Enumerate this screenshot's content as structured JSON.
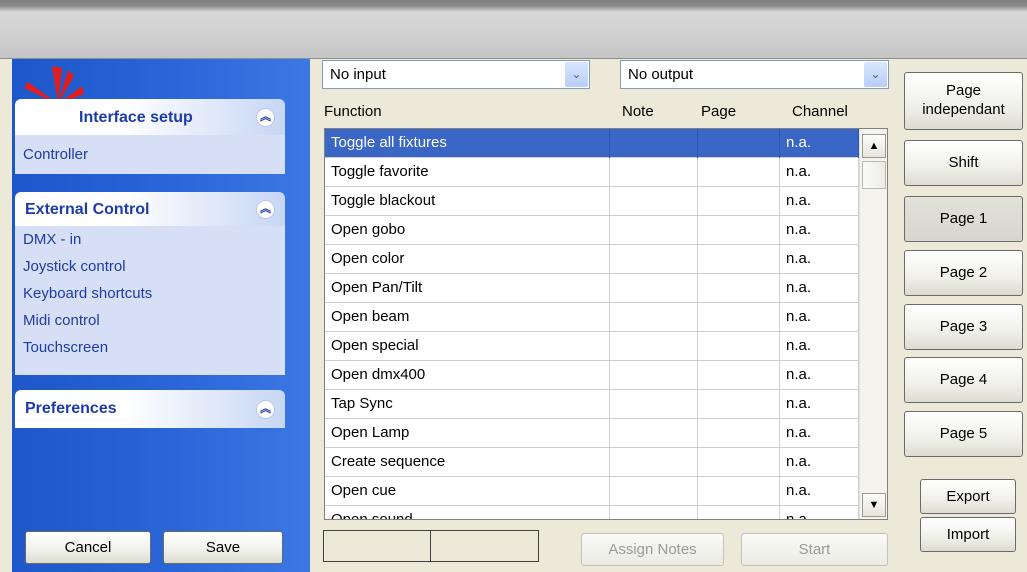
{
  "sidebar": {
    "groups": [
      {
        "title": "Interface setup",
        "items": [
          "Controller"
        ]
      },
      {
        "title": "External Control",
        "items": [
          "DMX - in",
          "Joystick control",
          "Keyboard shortcuts",
          "Midi control",
          "Touchscreen"
        ]
      },
      {
        "title": "Preferences",
        "items": []
      }
    ],
    "cancel_label": "Cancel",
    "save_label": "Save"
  },
  "input_select": {
    "value": "No input"
  },
  "output_select": {
    "value": "No output"
  },
  "table": {
    "columns": [
      "Function",
      "Note",
      "Page",
      "Channel"
    ],
    "rows": [
      {
        "function": "Toggle all fixtures",
        "note": "",
        "page": "",
        "channel": "n.a."
      },
      {
        "function": "Toggle favorite",
        "note": "",
        "page": "",
        "channel": "n.a."
      },
      {
        "function": "Toggle blackout",
        "note": "",
        "page": "",
        "channel": "n.a."
      },
      {
        "function": "Open gobo",
        "note": "",
        "page": "",
        "channel": "n.a."
      },
      {
        "function": "Open color",
        "note": "",
        "page": "",
        "channel": "n.a."
      },
      {
        "function": "Open Pan/Tilt",
        "note": "",
        "page": "",
        "channel": "n.a."
      },
      {
        "function": "Open beam",
        "note": "",
        "page": "",
        "channel": "n.a."
      },
      {
        "function": "Open special",
        "note": "",
        "page": "",
        "channel": "n.a."
      },
      {
        "function": "Open dmx400",
        "note": "",
        "page": "",
        "channel": "n.a."
      },
      {
        "function": "Tap Sync",
        "note": "",
        "page": "",
        "channel": "n.a."
      },
      {
        "function": "Open Lamp",
        "note": "",
        "page": "",
        "channel": "n.a."
      },
      {
        "function": "Create sequence",
        "note": "",
        "page": "",
        "channel": "n.a."
      },
      {
        "function": "Open cue",
        "note": "",
        "page": "",
        "channel": "n.a."
      },
      {
        "function": "Open sound",
        "note": "",
        "page": "",
        "channel": "n.a."
      }
    ],
    "selected_row": 0
  },
  "actions": {
    "assign_notes_label": "Assign Notes",
    "start_label": "Start"
  },
  "right_panel": {
    "page_independant_label": "Page independant",
    "shift_label": "Shift",
    "pages": [
      "Page 1",
      "Page 2",
      "Page 3",
      "Page 4",
      "Page 5"
    ],
    "active_page": "Page 1",
    "export_label": "Export",
    "import_label": "Import"
  },
  "icons": {
    "logo": "red-starburst-logo",
    "collapse": "double-chevron-up-icon",
    "dropdown": "chevron-down-icon"
  }
}
